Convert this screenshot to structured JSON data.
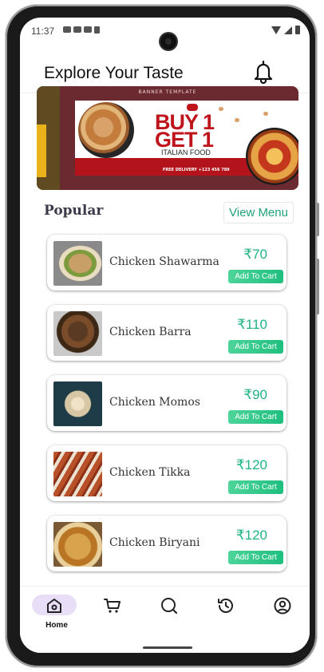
{
  "status_bar": {
    "time": "11:37"
  },
  "header": {
    "title": "Explore Your Taste",
    "bell_icon": "bell-icon"
  },
  "banner": {
    "ticker": "BANNER TEMPLATE",
    "headline_line1": "BUY 1",
    "headline_line2": "GET 1",
    "subtitle": "ITALIAN FOOD",
    "delivery": "FREE DELIVERY +123 456 789"
  },
  "popular": {
    "title": "Popular",
    "view_menu_label": "View Menu",
    "items": [
      {
        "name": "Chicken Shawarma",
        "price": "₹70",
        "button": "Add To Cart"
      },
      {
        "name": "Chicken Barra",
        "price": "₹110",
        "button": "Add To Cart"
      },
      {
        "name": "Chicken Momos",
        "price": "₹90",
        "button": "Add To Cart"
      },
      {
        "name": "Chicken Tikka",
        "price": "₹120",
        "button": "Add To Cart"
      },
      {
        "name": "Chicken Biryani",
        "price": "₹120",
        "button": "Add To Cart"
      }
    ]
  },
  "bottom_nav": {
    "items": [
      {
        "label": "Home",
        "icon": "home-icon",
        "active": true
      },
      {
        "label": "",
        "icon": "cart-icon",
        "active": false
      },
      {
        "label": "",
        "icon": "search-icon",
        "active": false
      },
      {
        "label": "",
        "icon": "history-icon",
        "active": false
      },
      {
        "label": "",
        "icon": "profile-icon",
        "active": false
      }
    ]
  },
  "colors": {
    "accent": "#1fb385",
    "button": "#2cc98a",
    "nav_active_bg": "#e8def7",
    "banner_bg": "#6b2a30"
  }
}
